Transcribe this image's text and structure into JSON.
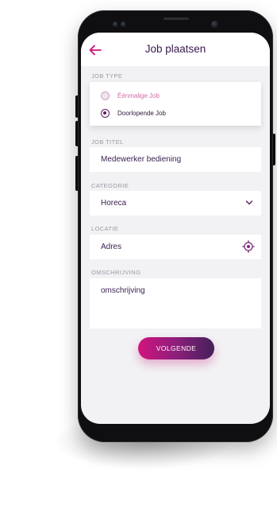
{
  "header": {
    "title": "Job plaatsen",
    "back_icon": "arrow-left-icon"
  },
  "job_type": {
    "label": "JOB TYPE",
    "options": [
      {
        "label": "Éénmalige Job",
        "selected": false
      },
      {
        "label": "Doorlopende Job",
        "selected": true
      }
    ]
  },
  "job_title": {
    "label": "JOB TITEL",
    "value": "Medewerker bediening"
  },
  "category": {
    "label": "CATEGORIE",
    "value": "Horeca",
    "icon": "chevron-down-icon"
  },
  "location": {
    "label": "LOCATIE",
    "placeholder": "Adres",
    "icon": "target-icon"
  },
  "description": {
    "label": "OMSCHRIJVING",
    "placeholder": "omschrijving"
  },
  "next_button": {
    "label": "VOLGENDE"
  },
  "colors": {
    "accent": "#5b1a5e",
    "title": "#3a1850",
    "pink": "#d46aa6",
    "button_start": "#d2147e",
    "button_end": "#432059",
    "screen_bg": "#f2f2f4"
  }
}
